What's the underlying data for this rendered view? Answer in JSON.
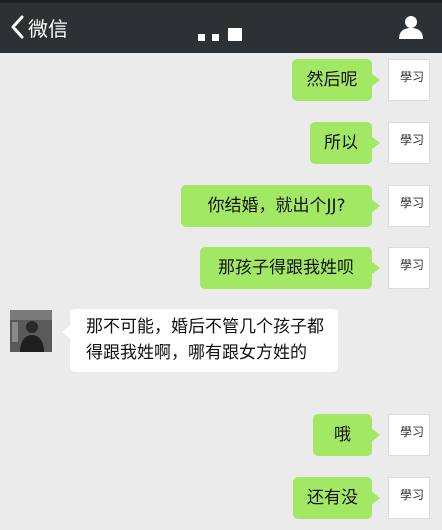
{
  "header": {
    "back_label": "微信"
  },
  "messages": [
    {
      "side": "out",
      "text": "然后呢"
    },
    {
      "side": "out",
      "text": "所以"
    },
    {
      "side": "out",
      "text": "你结婚，就出个JJ?"
    },
    {
      "side": "out",
      "text": "那孩子得跟我姓呗"
    },
    {
      "side": "in",
      "text": "那不可能，婚后不管几个孩子都得跟我姓啊，哪有跟女方姓的"
    },
    {
      "side": "out",
      "text": "哦"
    },
    {
      "side": "out",
      "text": "还有没"
    }
  ],
  "avatar_me_glyph": "學习",
  "colors": {
    "header_bg": "#2e3133",
    "chat_bg": "#ebebeb",
    "bubble_out": "#a3e864",
    "bubble_in": "#ffffff"
  },
  "icons": {
    "back": "chevron-left-icon",
    "contact": "person-icon"
  }
}
